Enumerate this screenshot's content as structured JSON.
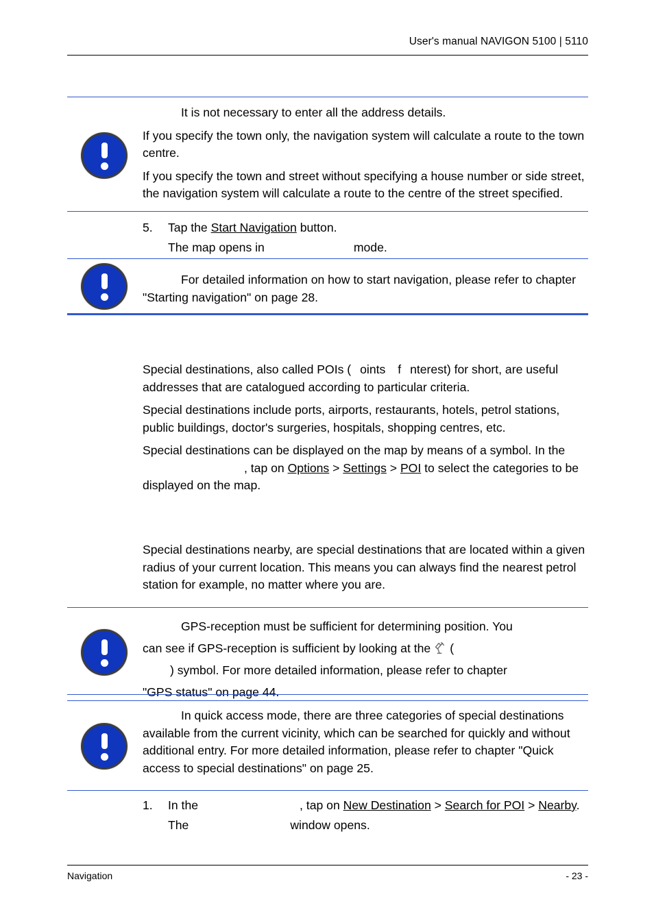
{
  "header": {
    "title": "User's manual NAVIGON 5100 | 5110"
  },
  "footer": {
    "left": "Navigation",
    "page": "- 23 -"
  },
  "colors": {
    "note_blue": "#1036be",
    "rule_blue": "#3159cf",
    "text": "#000000",
    "page_background": "#ffffff"
  },
  "notes": {
    "address_details": {
      "icon": "note-exclamation-icon",
      "paragraphs": [
        "It is not necessary to enter all the address details.",
        "If you specify the town only, the navigation system will calculate a route to the town centre.",
        "If you specify the town and street without specifying a house number or side street, the navigation system will calculate a route to the centre of the street specified."
      ]
    },
    "start_navigation": {
      "icon": "note-exclamation-icon",
      "text_before": "For detailed information on how to start navigation, please refer to chapter \"Starting navigation\" on page 28.",
      "chapter_reference": "Starting navigation",
      "page_reference": "28"
    },
    "gps_reception": {
      "icon": "note-exclamation-icon",
      "line1": "GPS-reception must be sufficient for determining position. You",
      "line2_before": "can see if GPS-reception is sufficient by looking at the",
      "satellite_icon": "gps-satellite-icon",
      "line2_after": "(",
      "line3": ") symbol. For more detailed information, please refer to chapter",
      "line4": "\"GPS status\" on page 44.",
      "chapter_reference": "GPS status",
      "page_reference": "44"
    },
    "quick_access": {
      "icon": "note-exclamation-icon",
      "text": "In quick access mode, there are three categories of special destinations available from the current vicinity, which can be searched for quickly and without additional entry. For more detailed information, please refer to chapter \"Quick access to special destinations\" on page 25.",
      "chapter_reference": "Quick access to special destinations",
      "page_reference": "25"
    }
  },
  "step5": {
    "number": "5.",
    "lead": "Tap the",
    "link": "Start Navigation",
    "trail": "button.",
    "result_before": "The map opens in",
    "result_mode": "",
    "result_after": "mode."
  },
  "poi_section": {
    "paragraph1": {
      "part1": "Special destinations, also called POIs (",
      "missing1": "",
      "part2": "oints",
      "missing2": "",
      "part3": "f",
      "missing3": "",
      "part4": "nterest) for short, are useful addresses that are catalogued according to particular criteria."
    },
    "paragraph2": "Special destinations include ports, airports, restaurants, hotels, petrol stations, public buildings, doctor's surgeries, hospitals, shopping centres, etc.",
    "paragraph3": {
      "part1": "Special destinations can be displayed on the map by means of a symbol. In the",
      "missing_window": "",
      "part2": ", tap on",
      "link_options": "Options",
      "sep1": ">",
      "link_settings": "Settings",
      "sep2": ">",
      "link_poi": "POI",
      "part3": "to select the categories to be displayed on the map."
    }
  },
  "nearby_section": {
    "paragraph": "Special destinations nearby, are special destinations that are located within a given radius of your current location. This means you can always find the nearest petrol station for example, no matter where you are."
  },
  "step1": {
    "number": "1.",
    "lead": "In the",
    "missing_window": "",
    "mid": ", tap on",
    "link_new_destination": "New Destination",
    "sep1": ">",
    "link_search_poi": "Search for POI",
    "sep2": ">",
    "link_nearby": "Nearby",
    "period": ".",
    "result_before": "The",
    "result_window": "",
    "result_after": "window opens."
  }
}
